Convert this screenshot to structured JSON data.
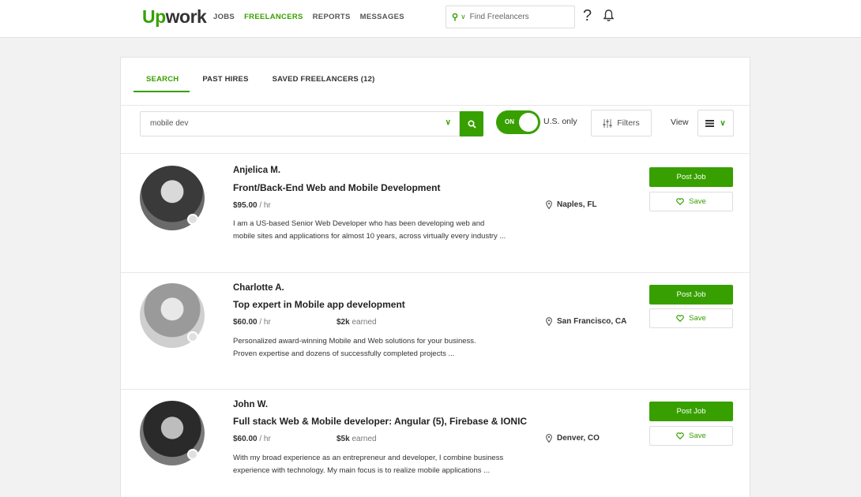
{
  "nav": {
    "logo_up": "Up",
    "logo_rest": "work",
    "links": [
      "JOBS",
      "FREELANCERS",
      "REPORTS",
      "MESSAGES"
    ],
    "active_link": "FREELANCERS",
    "search_placeholder": "Find Freelancers",
    "help": "?"
  },
  "tabs": [
    {
      "label": "SEARCH",
      "active": true
    },
    {
      "label": "PAST HIRES",
      "active": false
    },
    {
      "label": "SAVED FREELANCERS (12)",
      "active": false
    }
  ],
  "search": {
    "query": "mobile dev",
    "toggle_label": "ON",
    "toggle_caption": "U.S. only",
    "filters_label": "Filters",
    "view_label": "View"
  },
  "results": [
    {
      "name": "Anjelica M.",
      "title": "Front/Back-End Web and Mobile Development",
      "rate": "$95.00",
      "rate_unit": "/ hr",
      "earned_amount": "",
      "earned_label": "",
      "location": "Naples, FL",
      "description_line1": "I am a US-based Senior Web Developer who has been developing web and",
      "description_line2": "mobile sites and applications for almost 10 years, across virtually every industry ...",
      "post_job_label": "Post Job",
      "save_label": "Save"
    },
    {
      "name": "Charlotte A.",
      "title": "Top expert in Mobile app development",
      "rate": "$60.00",
      "rate_unit": "/ hr",
      "earned_amount": "$2k",
      "earned_label": "earned",
      "location": "San Francisco, CA",
      "description_line1": "Personalized award-winning Mobile and Web solutions for your business.",
      "description_line2": "Proven expertise and dozens of successfully completed projects ...",
      "post_job_label": "Post Job",
      "save_label": "Save"
    },
    {
      "name": "John W.",
      "title": "Full stack Web & Mobile developer: Angular (5), Firebase & IONIC",
      "rate": "$60.00",
      "rate_unit": "/ hr",
      "earned_amount": "$5k",
      "earned_label": "earned",
      "location": "Denver, CO",
      "description_line1": "With my broad experience as an entrepreneur and developer, I combine business",
      "description_line2": "experience with technology. My main focus is to realize mobile applications ...",
      "post_job_label": "Post Job",
      "save_label": "Save"
    }
  ],
  "colors": {
    "brand": "#37a000"
  }
}
